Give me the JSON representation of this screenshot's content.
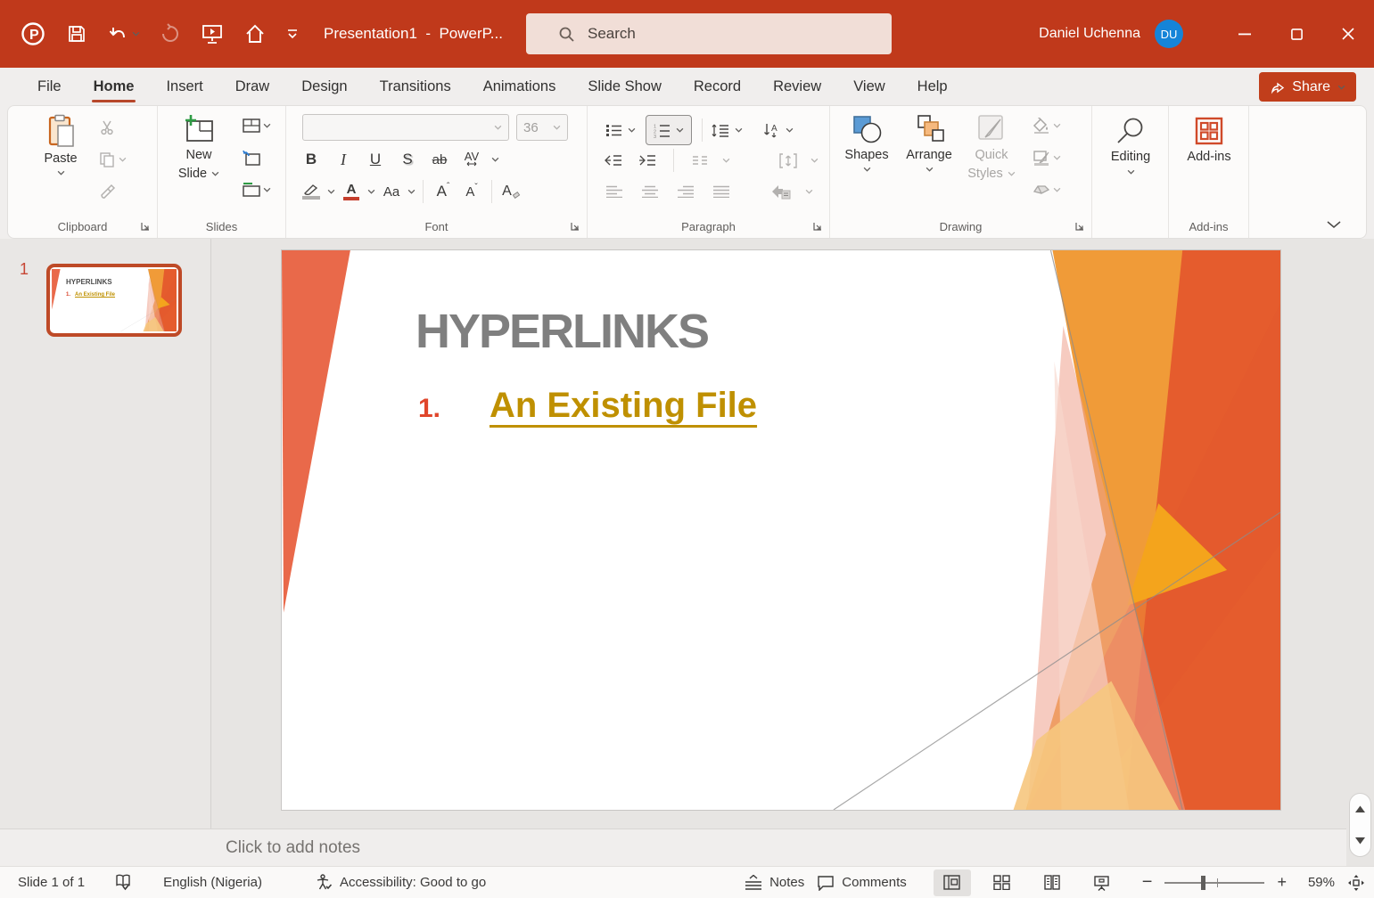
{
  "titlebar": {
    "app_title": "Presentation1  -  PowerP...",
    "search_placeholder": "Search",
    "user_name": "Daniel Uchenna",
    "user_initials": "DU"
  },
  "ribbon": {
    "tabs": [
      "File",
      "Home",
      "Insert",
      "Draw",
      "Design",
      "Transitions",
      "Animations",
      "Slide Show",
      "Record",
      "Review",
      "View",
      "Help"
    ],
    "active_tab": "Home",
    "share_label": "Share",
    "clipboard": {
      "label": "Clipboard",
      "paste": "Paste"
    },
    "slides": {
      "label": "Slides",
      "new_slide_line1": "New",
      "new_slide_line2": "Slide"
    },
    "font": {
      "label": "Font",
      "size_value": "36"
    },
    "paragraph": {
      "label": "Paragraph"
    },
    "drawing": {
      "label": "Drawing",
      "shapes": "Shapes",
      "arrange": "Arrange",
      "quick_line1": "Quick",
      "quick_line2": "Styles"
    },
    "editing": {
      "label": "Editing"
    },
    "addins": {
      "label": "Add-ins",
      "group_label": "Add-ins"
    }
  },
  "thumbnails": {
    "slide_number": "1"
  },
  "slide": {
    "title": "HYPERLINKS",
    "bullet_number": "1.",
    "link_text": "An Existing File"
  },
  "notes": {
    "placeholder": "Click to add notes"
  },
  "statusbar": {
    "slide_indicator": "Slide 1 of 1",
    "language": "English (Nigeria)",
    "accessibility": "Accessibility: Good to go",
    "notes": "Notes",
    "comments": "Comments",
    "zoom": "59%"
  },
  "colors": {
    "brand": "#C0391B",
    "hyperlink": "#BF9000",
    "title_gray": "#7F7F7F",
    "accent_orange": "#E9694A",
    "avatar_blue": "#1584D8"
  }
}
